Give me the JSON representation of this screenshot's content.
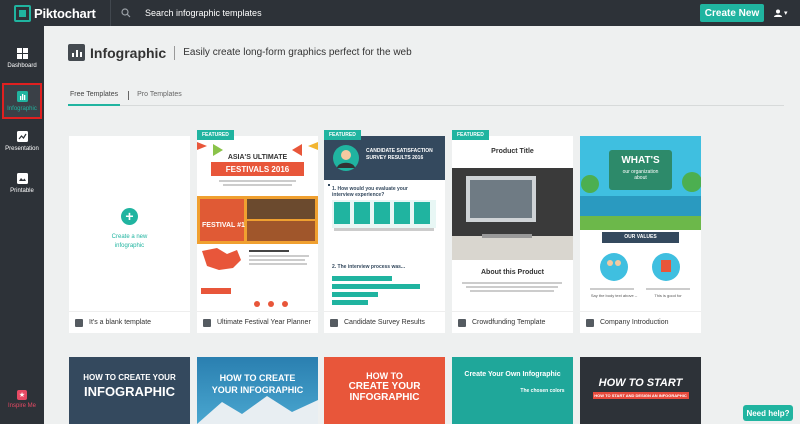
{
  "app": {
    "brand": "Piktochart"
  },
  "topbar": {
    "search_placeholder": "Search infographic templates",
    "create_label": "Create New"
  },
  "sidebar": {
    "items": [
      {
        "label": "Dashboard",
        "icon": "grid-icon"
      },
      {
        "label": "Infographic",
        "icon": "infographic-icon",
        "active": true
      },
      {
        "label": "Presentation",
        "icon": "presentation-icon"
      },
      {
        "label": "Printable",
        "icon": "printable-icon"
      }
    ],
    "inspire_label": "Inspire Me"
  },
  "header": {
    "title": "Infographic",
    "subtitle": "Easily create long-form graphics perfect for the web"
  },
  "tabs": [
    {
      "label": "Free Templates",
      "active": true
    },
    {
      "label": "Pro Templates",
      "active": false
    }
  ],
  "badge": {
    "featured": "FEATURED"
  },
  "blank_card": {
    "line1": "Create a new",
    "line2": "infographic"
  },
  "thumb_text": {
    "festival": {
      "asia": "ASIA'S ULTIMATE",
      "festivals": "FESTIVALS 2016",
      "num": "FESTIVAL #1"
    },
    "survey": {
      "title1": "CANDIDATE SATISFACTION",
      "title2": "SURVEY RESULTS 2016",
      "q1": "1. How would you evaluate your",
      "q1b": "interview experience?",
      "q2": "2. The interview process was..."
    },
    "product": {
      "title": "Product Title",
      "about": "About this Product"
    },
    "company": {
      "whats": "WHAT'S",
      "sub1": "our organization",
      "sub2": "about",
      "values": "OUR VALUES",
      "cap1": "Say the body text above –",
      "cap2": "This is good for"
    }
  },
  "templates": [
    {
      "name": "It's a blank template"
    },
    {
      "name": "Ultimate Festival Year Planner"
    },
    {
      "name": "Candidate Survey Results"
    },
    {
      "name": "Crowdfunding Template"
    },
    {
      "name": "Company Introduction"
    }
  ],
  "bottom_templates": [
    {
      "line1": "HOW TO CREATE YOUR",
      "line2": "INFOGRAPHIC"
    },
    {
      "line1": "HOW TO CREATE",
      "line2": "YOUR INFOGRAPHIC"
    },
    {
      "line1": "HOW TO",
      "line2": "CREATE YOUR",
      "line3": "INFOGRAPHIC"
    },
    {
      "line1": "Create Your Own Infographic",
      "line2": "The chosen colors"
    },
    {
      "line1": "HOW TO START",
      "line2": "HOW TO START AND DESIGN AN INFOGRAPHIC"
    }
  ],
  "help": {
    "label": "Need help?"
  },
  "colors": {
    "accent": "#20b4a0",
    "sidebar": "#2d3238",
    "highlight": "#e02020"
  }
}
